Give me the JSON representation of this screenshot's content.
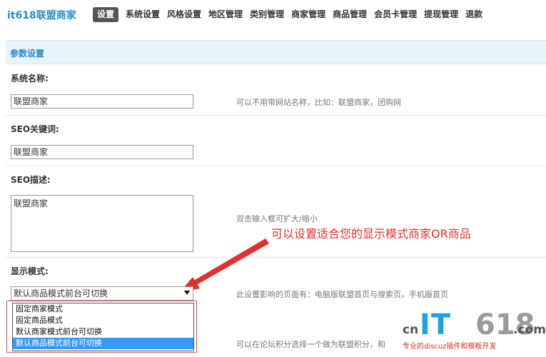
{
  "header": {
    "brand": "it618联盟商家",
    "nav": [
      "设置",
      "系统设置",
      "风格设置",
      "地区管理",
      "类别管理",
      "商家管理",
      "商品管理",
      "会员卡管理",
      "提现管理",
      "退款"
    ]
  },
  "section": {
    "title": "参数设置"
  },
  "fields": {
    "system_name": {
      "label": "系统名称:",
      "value": "联盟商家",
      "hint": "可以不用带网站名称，比如：联盟商家，团购网"
    },
    "seo_keywords": {
      "label": "SEO关键词:",
      "value": "联盟商家"
    },
    "seo_description": {
      "label": "SEO描述:",
      "value": "联盟商家",
      "hint": "双击输入框可扩大/缩小"
    },
    "display_mode": {
      "label": "显示模式:",
      "value": "默认商品模式前台可切换",
      "hint": "此设置影响的页面有：电脑版联盟首页与搜索页，手机版首页",
      "options": [
        "固定商家模式",
        "固定商品模式",
        "默认商家模式前台可切换",
        "默认商品模式前台可切换"
      ]
    },
    "next_hint": "可以在论坛积分选择一个做为联盟积分，和"
  },
  "annotation": "可以设置适合您的显示模式商家OR商品",
  "logo": {
    "cn": "cn",
    "it": "IT",
    "num": "618",
    "com": ".com",
    "sub": "专业的discuz插件和模板开发"
  },
  "colors": {
    "accent": "#2a8cc7",
    "annotation": "#e0312c",
    "selected": "#3399ff"
  }
}
